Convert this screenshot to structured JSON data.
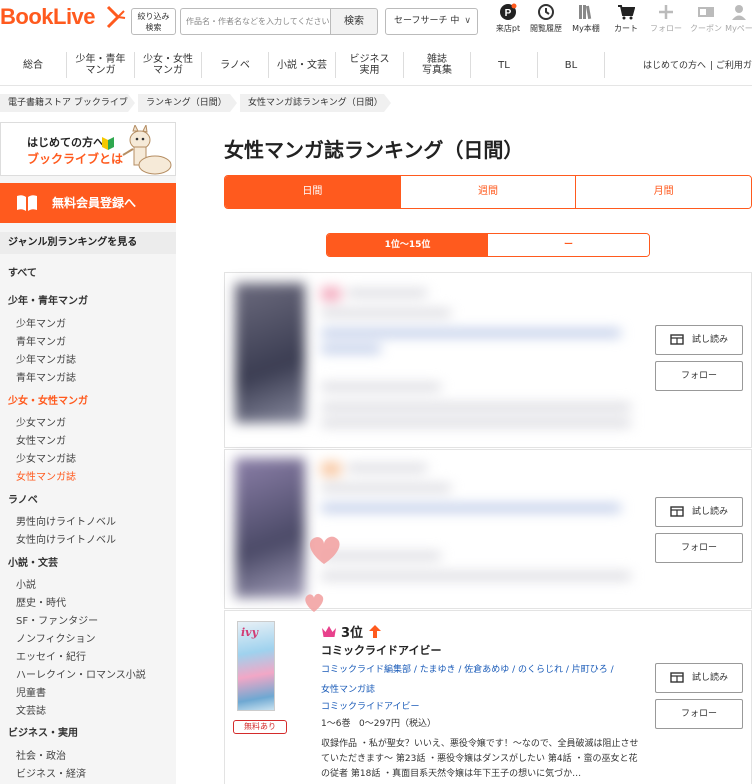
{
  "header": {
    "logo": "BookLive",
    "narrow_search": "絞り込み\n検索",
    "search_placeholder": "作品名・作者名などを入力してください",
    "search_button": "検索",
    "safe_search": "セーフサーチ 中",
    "icons": [
      {
        "name": "visit-pt-icon",
        "label": "来店pt"
      },
      {
        "name": "history-icon",
        "label": "閲覧履歴"
      },
      {
        "name": "bookshelf-icon",
        "label": "My本棚"
      },
      {
        "name": "cart-icon",
        "label": "カート"
      },
      {
        "name": "plus-icon",
        "label": "フォロー"
      },
      {
        "name": "coupon-icon",
        "label": "クーポン"
      },
      {
        "name": "mypage-icon",
        "label": "Myペー"
      }
    ]
  },
  "catnav": {
    "items": [
      "総合",
      "少年・青年\nマンガ",
      "少女・女性\nマンガ",
      "ラノベ",
      "小説・文芸",
      "ビジネス\n実用",
      "雑誌\n写真集",
      "TL",
      "BL"
    ],
    "right_links": [
      "はじめての方へ",
      "ご利用ガ"
    ]
  },
  "breadcrumb": [
    "電子書籍ストア ブックライブ",
    "ランキング（日間）",
    "女性マンガ誌ランキング（日間）"
  ],
  "sidebar": {
    "banner_line1": "はじめての方へ",
    "banner_line2": "ブックライブとは",
    "member_button": "無料会員登録へ",
    "genre_title": "ジャンル別ランキングを見る",
    "links": [
      {
        "text": "すべて",
        "type": "h"
      },
      {
        "text": "少年・青年マンガ",
        "type": "h"
      },
      {
        "text": "少年マンガ",
        "type": "s"
      },
      {
        "text": "青年マンガ",
        "type": "s"
      },
      {
        "text": "少年マンガ誌",
        "type": "s"
      },
      {
        "text": "青年マンガ誌",
        "type": "s"
      },
      {
        "text": "少女・女性マンガ",
        "type": "h",
        "active": true
      },
      {
        "text": "少女マンガ",
        "type": "s"
      },
      {
        "text": "女性マンガ",
        "type": "s"
      },
      {
        "text": "少女マンガ誌",
        "type": "s"
      },
      {
        "text": "女性マンガ誌",
        "type": "s",
        "active": true
      },
      {
        "text": "ラノベ",
        "type": "h"
      },
      {
        "text": "男性向けライトノベル",
        "type": "s"
      },
      {
        "text": "女性向けライトノベル",
        "type": "s"
      },
      {
        "text": "小説・文芸",
        "type": "h"
      },
      {
        "text": "小説",
        "type": "s"
      },
      {
        "text": "歴史・時代",
        "type": "s"
      },
      {
        "text": "SF・ファンタジー",
        "type": "s"
      },
      {
        "text": "ノンフィクション",
        "type": "s"
      },
      {
        "text": "エッセイ・紀行",
        "type": "s"
      },
      {
        "text": "ハーレクイン・ロマンス小説",
        "type": "s"
      },
      {
        "text": "児童書",
        "type": "s"
      },
      {
        "text": "文芸誌",
        "type": "s"
      },
      {
        "text": "ビジネス・実用",
        "type": "h"
      },
      {
        "text": "社会・政治",
        "type": "s"
      },
      {
        "text": "ビジネス・経済",
        "type": "s"
      }
    ]
  },
  "main": {
    "title": "女性マンガ誌ランキング（日間）",
    "tabs": [
      {
        "label": "日間",
        "active": true
      },
      {
        "label": "週間",
        "active": false
      },
      {
        "label": "月間",
        "active": false
      }
    ],
    "ranges": [
      {
        "label": "1位〜15位",
        "active": true
      },
      {
        "label": "ー",
        "active": false
      }
    ],
    "try_read": "試し読み",
    "follow": "フォロー",
    "item3": {
      "rank": "3位",
      "cover_title": "ivy",
      "title": "コミックライドアイビー",
      "authors": "コミックライド編集部 / たまゆき / 佐倉あめゆ / のくらじれ / 片町ひろ /",
      "genre": "女性マンガ誌",
      "label": "コミックライドアイビー",
      "volumes": "1〜6巻",
      "price": "0〜297円（税込）",
      "free_badge": "無料あり",
      "description": "収録作品 ・私が聖女？いいえ、悪役令嬢です！〜なので、全員破滅は阻止させていただきます〜 第23話 ・悪役令嬢はダンスがしたい 第4話 ・蛮の巫女と花の従者 第18話 ・真面目系天然令嬢は年下王子の想いに気づか…"
    }
  },
  "colors": {
    "accent": "#ff5a1e",
    "link": "#1a5bb8",
    "free_badge": "#d42b2b"
  }
}
